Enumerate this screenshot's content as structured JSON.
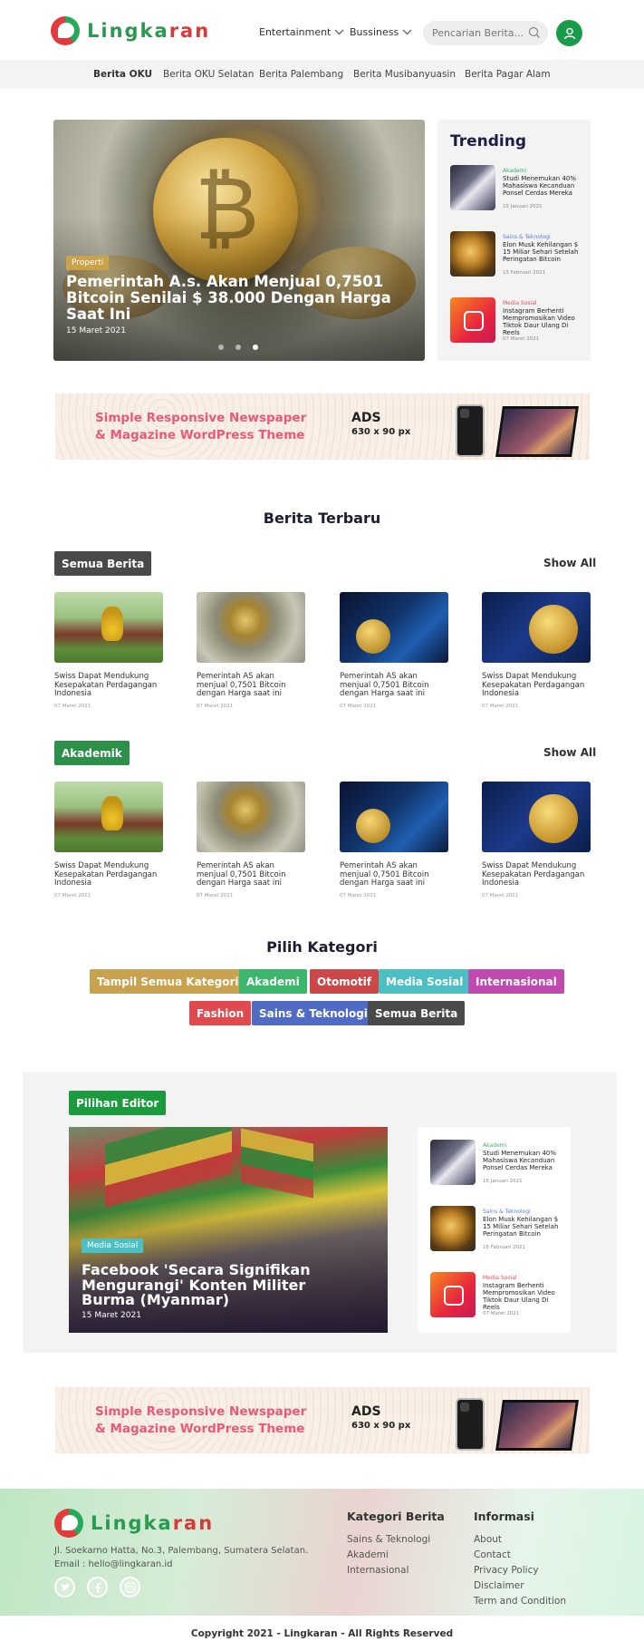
{
  "brand": {
    "name_part1": "Lingka",
    "name_part2": "ran"
  },
  "header": {
    "nav": [
      "Entertainment",
      "Bussiness"
    ],
    "search_placeholder": "Pencarian Berita..."
  },
  "subnav": [
    "Berita OKU",
    "Berita OKU Selatan",
    "Berita Palembang",
    "Berita Musibanyuasin",
    "Berita Pagar Alam"
  ],
  "hero": {
    "tag": "Properti",
    "title": "Pemerintah A.s. Akan Menjual 0,7501 Bitcoin Senilai $ 38.000 Dengan Harga Saat Ini",
    "date": "15 Maret 2021"
  },
  "trending": {
    "title": "Trending",
    "items": [
      {
        "category": "Akademi",
        "title": "Studi Menemukan 40% Mahasiswa Kecanduan Ponsel Cerdas Mereka",
        "date": "15 Januari 2021"
      },
      {
        "category": "Sains & Teknologi",
        "title": "Elon Musk Kehilangan $ 15 Miliar Sehari Setelah Peringatan Bitcoin",
        "date": "15 Februari 2021"
      },
      {
        "category": "Media Sosial",
        "title": "Instagram Berhenti Mempromosikan Video Tiktok Daur Ulang Di Reels",
        "date": "07 Maret 2021"
      }
    ]
  },
  "ads": {
    "slogan": "Simple Responsive Newspaper & Magazine WordPress Theme",
    "label": "ADS",
    "size": "630 x 90 px"
  },
  "latest": {
    "title": "Berita Terbaru",
    "show_all": "Show All",
    "groups": [
      {
        "chip": "Semua Berita",
        "cards": [
          {
            "title": "Swiss Dapat Mendukung Kesepakatan Perdagangan Indonesia",
            "date": "07 Maret 2021"
          },
          {
            "title": "Pemerintah AS akan menjual 0,7501 Bitcoin dengan Harga saat ini",
            "date": "07 Maret 2021"
          },
          {
            "title": "Pemerintah AS akan menjual 0,7501 Bitcoin dengan Harga saat ini",
            "date": "07 Maret 2021"
          },
          {
            "title": "Swiss Dapat Mendukung Kesepakatan Perdagangan Indonesia",
            "date": "07 Maret 2021"
          }
        ]
      },
      {
        "chip": "Akademik",
        "cards": [
          {
            "title": "Swiss Dapat Mendukung Kesepakatan Perdagangan Indonesia",
            "date": "07 Maret 2021"
          },
          {
            "title": "Pemerintah AS akan menjual 0,7501 Bitcoin dengan Harga saat ini",
            "date": "07 Maret 2021"
          },
          {
            "title": "Pemerintah AS akan menjual 0,7501 Bitcoin dengan Harga saat ini",
            "date": "07 Maret 2021"
          },
          {
            "title": "Swiss Dapat Mendukung Kesepakatan Perdagangan Indonesia",
            "date": "07 Maret 2021"
          }
        ]
      }
    ]
  },
  "categories": {
    "title": "Pilih Kategori",
    "items": [
      {
        "label": "Tampil Semua Kategori",
        "color": "#c8a24f"
      },
      {
        "label": "Akademi",
        "color": "#3cb66a"
      },
      {
        "label": "Otomotif",
        "color": "#cc4848"
      },
      {
        "label": "Media Sosial",
        "color": "#4bbfc4"
      },
      {
        "label": "Internasional",
        "color": "#c04ab0"
      },
      {
        "label": "Fashion",
        "color": "#e04a4f"
      },
      {
        "label": "Sains & Teknologi",
        "color": "#4f6bc4"
      },
      {
        "label": "Semua Berita",
        "color": "#4a4a4a"
      }
    ]
  },
  "editor": {
    "chip": "Pilihan Editor",
    "feature": {
      "tag": "Media Sosial",
      "title": "Facebook 'Secara Signifikan Mengurangi' Konten Militer Burma (Myanmar)",
      "date": "15 Maret 2021"
    },
    "items": [
      {
        "category": "Akademi",
        "title": "Studi Menemukan 40% Mahasiswa Kecanduan Ponsel Cerdas Mereka",
        "date": "15 Januari 2021"
      },
      {
        "category": "Sains & Teknologi",
        "title": "Elon Musk Kehilangan $ 15 Miliar Sehari Setelah Peringatan Bitcoin",
        "date": "15 Februari 2021"
      },
      {
        "category": "Media Sosial",
        "title": "Instagram Berhenti Mempromosikan Video Tiktok Daur Ulang Di Reels",
        "date": "07 Maret 2021"
      }
    ]
  },
  "footer": {
    "address": "Jl. Soekarno Hatta, No.3, Palembang, Sumatera Selatan.",
    "email": "Email : hello@lingkaran.id",
    "col1": {
      "title": "Kategori Berita",
      "links": [
        "Sains & Teknologi",
        "Akademi",
        "Internasional"
      ]
    },
    "col2": {
      "title": "Informasi",
      "links": [
        "About",
        "Contact",
        "Privacy Policy",
        "Disclaimer",
        "Term and Condition"
      ]
    },
    "copyright": "Copyright 2021 - Lingkaran - All Rights Reserved"
  },
  "colors": {
    "brand_green": "#2a9a50",
    "brand_red": "#d83a3a",
    "chip_semua": "#4a4a4a",
    "chip_akademik": "#2c8f4a",
    "chip_editor": "#1b9a3e",
    "cat_akademi": "#3bb06a",
    "cat_sains": "#5b7fd6",
    "cat_media": "#e04a55"
  }
}
